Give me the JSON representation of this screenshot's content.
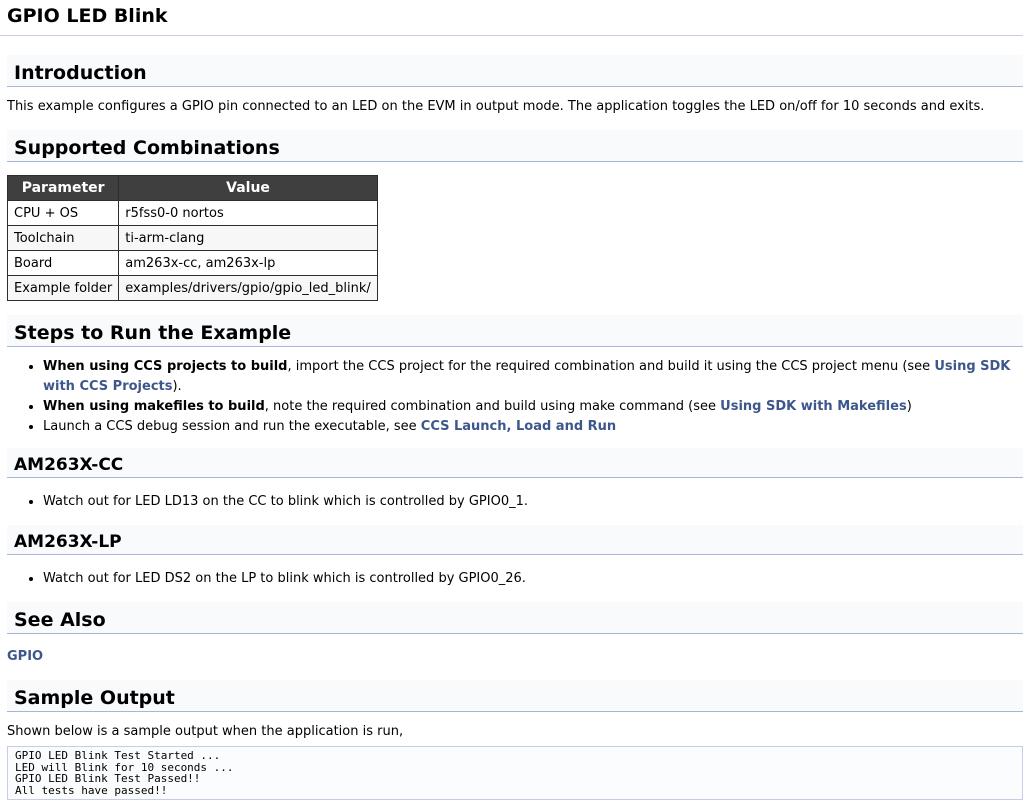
{
  "page_title": "GPIO LED Blink",
  "introduction": {
    "heading": "Introduction",
    "text": "This example configures a GPIO pin connected to an LED on the EVM in output mode. The application toggles the LED on/off for 10 seconds and exits."
  },
  "supported": {
    "heading": "Supported Combinations",
    "columns": [
      "Parameter",
      "Value"
    ],
    "rows": [
      [
        "CPU + OS",
        "r5fss0-0 nortos"
      ],
      [
        "Toolchain",
        "ti-arm-clang"
      ],
      [
        "Board",
        "am263x-cc, am263x-lp"
      ],
      [
        "Example folder",
        "examples/drivers/gpio/gpio_led_blink/"
      ]
    ]
  },
  "steps": {
    "heading": "Steps to Run the Example",
    "item1": {
      "bold": "When using CCS projects to build",
      "text": ", import the CCS project for the required combination and build it using the CCS project menu (see ",
      "link": "Using SDK with CCS Projects",
      "tail": ")."
    },
    "item2": {
      "bold": "When using makefiles to build",
      "text": ", note the required combination and build using make command (see ",
      "link": "Using SDK with Makefiles",
      "tail": ")"
    },
    "item3": {
      "text": "Launch a CCS debug session and run the executable, see ",
      "link": "CCS Launch, Load and Run"
    }
  },
  "am263x_cc": {
    "heading": "AM263X-CC",
    "item": "Watch out for LED LD13 on the CC to blink which is controlled by GPIO0_1."
  },
  "am263x_lp": {
    "heading": "AM263X-LP",
    "item": "Watch out for LED DS2 on the LP to blink which is controlled by GPIO0_26."
  },
  "see_also": {
    "heading": "See Also",
    "link": "GPIO"
  },
  "sample_output": {
    "heading": "Sample Output",
    "text": "Shown below is a sample output when the application is run,",
    "code": "GPIO LED Blink Test Started ...\nLED will Blink for 10 seconds ...\nGPIO LED Blink Test Passed!!\nAll tests have passed!!"
  },
  "colors": {
    "link": "#3d578c",
    "table_header_bg": "#3f3f3f",
    "section_border": "#a5b6d6"
  }
}
